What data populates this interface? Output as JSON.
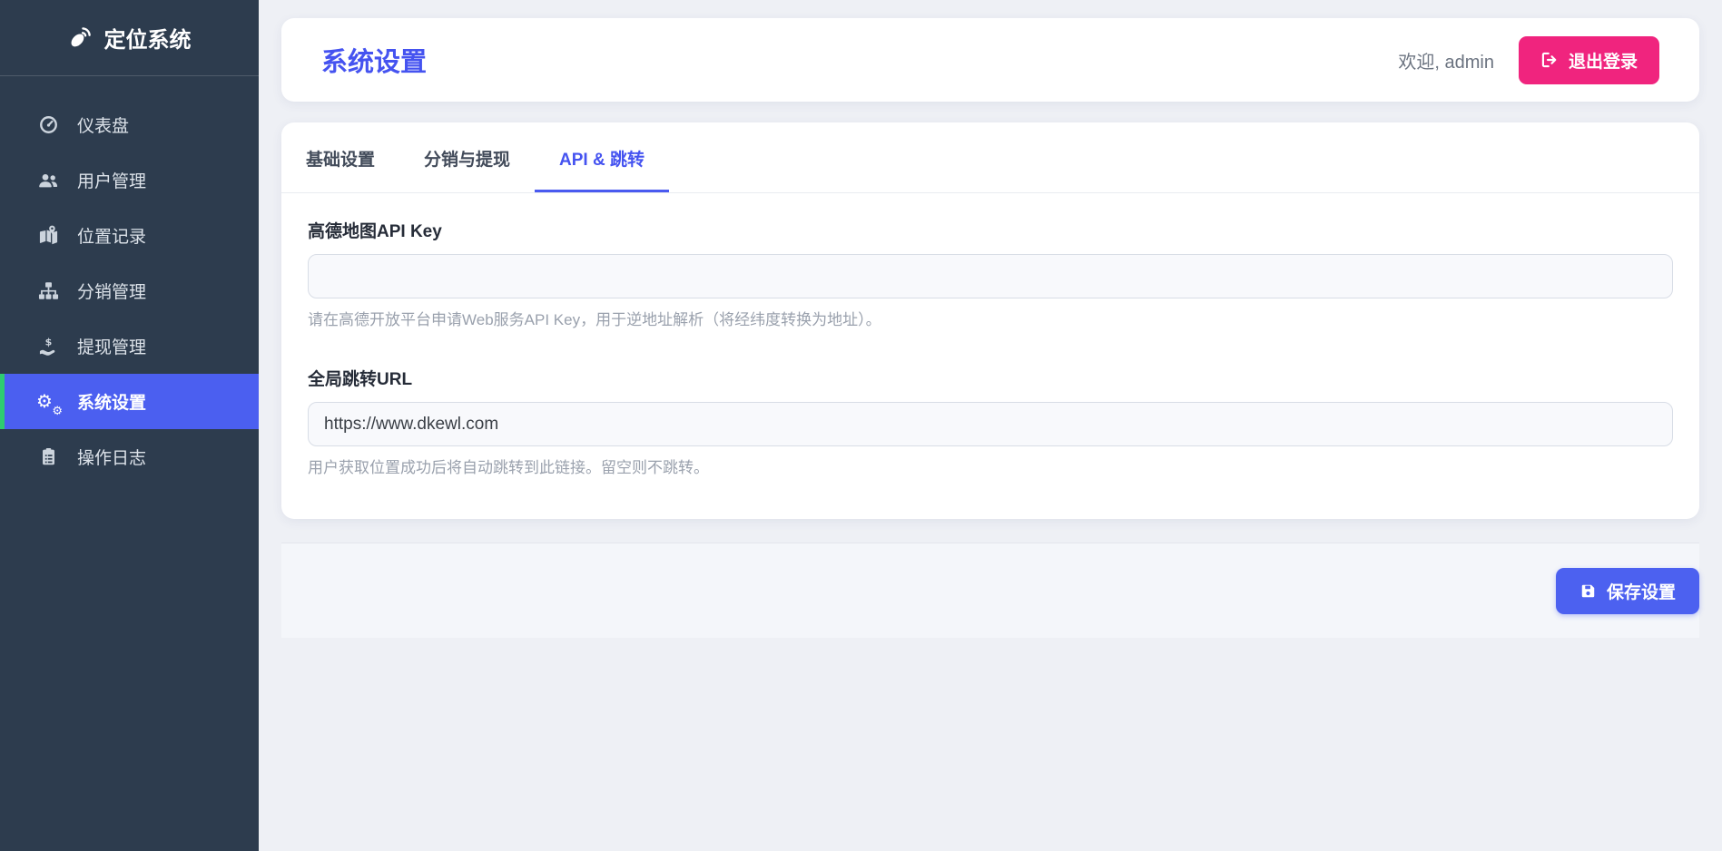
{
  "app": {
    "name": "定位系统"
  },
  "sidebar": {
    "items": [
      {
        "label": "仪表盘"
      },
      {
        "label": "用户管理"
      },
      {
        "label": "位置记录"
      },
      {
        "label": "分销管理"
      },
      {
        "label": "提现管理"
      },
      {
        "label": "系统设置"
      },
      {
        "label": "操作日志"
      }
    ],
    "active_index": 5
  },
  "header": {
    "title": "系统设置",
    "welcome": "欢迎, admin",
    "logout_label": "退出登录"
  },
  "tabs": {
    "items": [
      {
        "label": "基础设置"
      },
      {
        "label": "分销与提现"
      },
      {
        "label": "API & 跳转"
      }
    ],
    "active_index": 2
  },
  "form": {
    "amap": {
      "label": "高德地图API Key",
      "value": "",
      "help": "请在高德开放平台申请Web服务API Key，用于逆地址解析（将经纬度转换为地址）。"
    },
    "redirect": {
      "label": "全局跳转URL",
      "value": "https://www.dkewl.com",
      "help": "用户获取位置成功后将自动跳转到此链接。留空则不跳转。"
    }
  },
  "footer": {
    "save_label": "保存设置"
  },
  "colors": {
    "primary": "#4553f0",
    "primary_button": "#4c61f0",
    "sidebar_bg": "#2d3c4e",
    "sidebar_active_bg": "#4b5ff0",
    "active_stripe": "#2ecc71",
    "logout_pink": "#f0247e",
    "page_bg": "#eef0f5"
  }
}
